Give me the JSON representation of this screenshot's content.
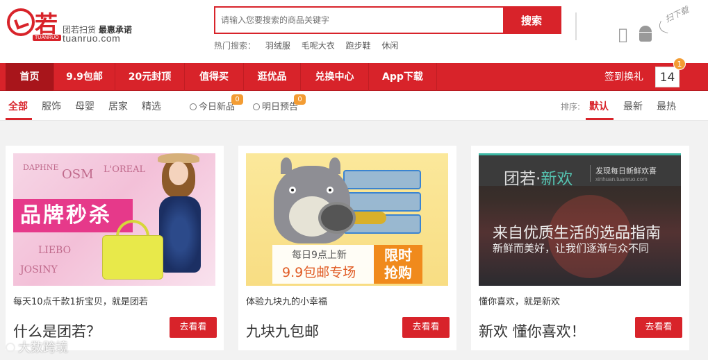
{
  "header": {
    "logo_char": "若",
    "logo_en": "TUANRUO",
    "slogan_part1": "团若扫货",
    "slogan_part2": "最惠承诺",
    "domain": "tuanruo.com",
    "search": {
      "placeholder": "请输入您要搜索的商品关键字",
      "button_label": "搜索"
    },
    "hot_search_label": "热门搜索：",
    "hot_search_items": [
      "羽绒服",
      "毛呢大衣",
      "跑步鞋",
      "休闲"
    ],
    "download_note": "扫下载"
  },
  "nav": {
    "items": [
      "首页",
      "9.9包邮",
      "20元封顶",
      "值得买",
      "逛优品",
      "兑换中心",
      "App下载"
    ],
    "sign_label": "签到换礼",
    "sign_count": "14",
    "sign_badge": "1"
  },
  "subnav": {
    "categories": [
      "全部",
      "服饰",
      "母婴",
      "居家",
      "精选"
    ],
    "today_new": "今日新品",
    "today_badge": "0",
    "tomorrow_preview": "明日预告",
    "tomorrow_badge": "0",
    "sort_label": "排序:",
    "sort_options": [
      "默认",
      "最新",
      "最热"
    ]
  },
  "cards": [
    {
      "desc": "每天10点千款1折宝贝，就是团若",
      "title": "什么是团若？",
      "button": "去看看",
      "image": {
        "banner": "品牌秒杀",
        "brands": [
          "DAPHNE",
          "OSM",
          "L'OREAL",
          "LIEBO",
          "JOSINY"
        ]
      }
    },
    {
      "desc": "体验九块九的小幸福",
      "title": "九块九包邮",
      "button": "去看看",
      "image": {
        "line1": "每日9点上新",
        "line2": "9.9包邮专场",
        "badge_line1": "限时",
        "badge_line2": "抢购"
      }
    },
    {
      "desc": "懂你喜欢，就是新欢",
      "title": "新欢 懂你喜欢！",
      "button": "去看看",
      "image": {
        "brand_prefix": "团若",
        "brand_dot": "·",
        "brand_suffix": "新欢",
        "subtitle": "发现每日新鲜欢喜",
        "url": "xinhuan.tuanruo.com",
        "line1": "来自优质生活的选品指南",
        "line2": "新鲜而美好，让我们逐渐与众不同"
      }
    }
  ],
  "watermark": "大数跨境",
  "colors": {
    "brand_red": "#d8232a",
    "badge_orange": "#f39c33",
    "accent_teal": "#55c3b0"
  }
}
